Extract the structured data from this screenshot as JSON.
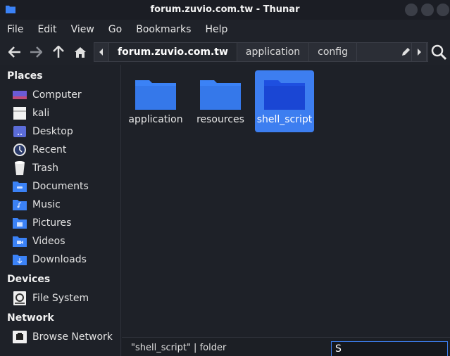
{
  "window": {
    "title": "forum.zuvio.com.tw - Thunar"
  },
  "menu": [
    "File",
    "Edit",
    "View",
    "Go",
    "Bookmarks",
    "Help"
  ],
  "path": {
    "crumbs": [
      "forum.zuvio.com.tw",
      "application",
      "config"
    ],
    "active_index": 0
  },
  "sidebar": {
    "places_header": "Places",
    "places": [
      "Computer",
      "kali",
      "Desktop",
      "Recent",
      "Trash",
      "Documents",
      "Music",
      "Pictures",
      "Videos",
      "Downloads"
    ],
    "devices_header": "Devices",
    "devices": [
      "File System"
    ],
    "network_header": "Network",
    "network": [
      "Browse Network"
    ]
  },
  "files": [
    {
      "name": "application",
      "selected": false
    },
    {
      "name": "resources",
      "selected": false
    },
    {
      "name": "shell_script",
      "selected": true
    }
  ],
  "status": {
    "text": "\"shell_script\" | folder",
    "typeahead_value": "S"
  },
  "colors": {
    "accent": "#3d7ef0",
    "folder": "#3b82f6",
    "folder_selected": "#1e4fe0",
    "background": "#1e2128"
  }
}
